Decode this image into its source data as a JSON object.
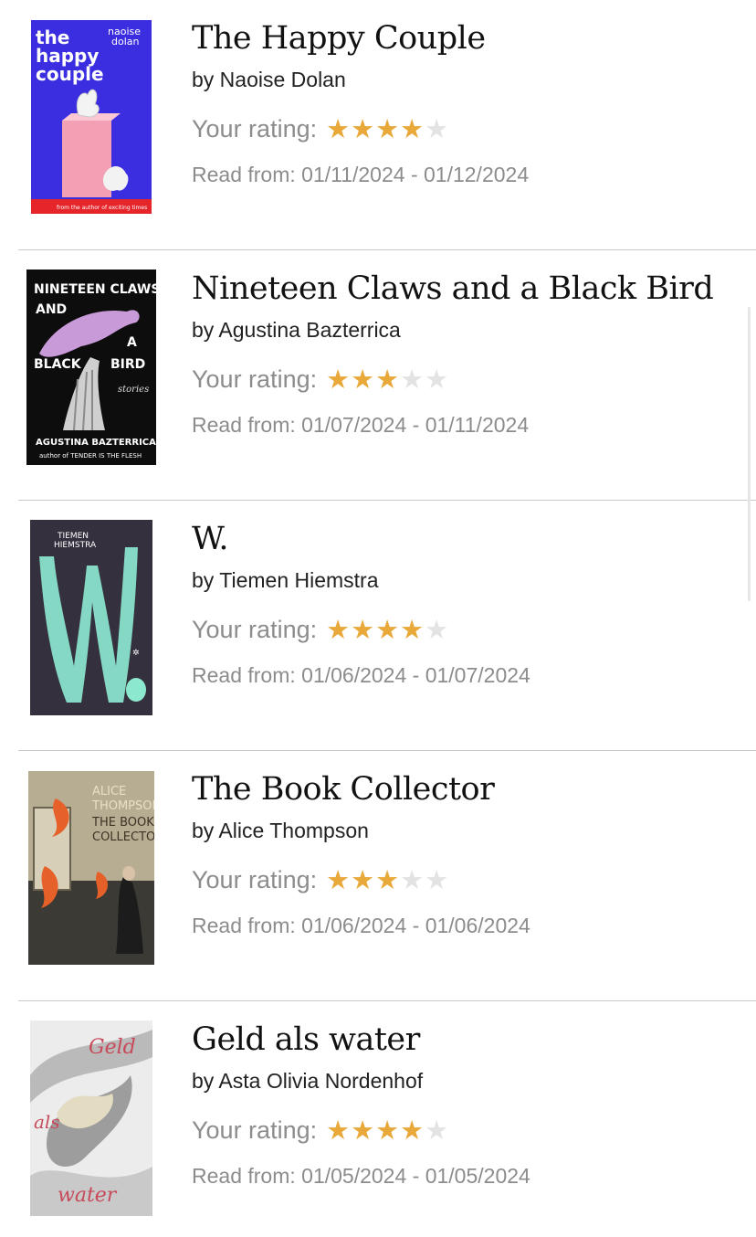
{
  "labels": {
    "rating_prefix": "Your rating:"
  },
  "colors": {
    "star_on": "#e8a93a",
    "star_off": "#e3e3e3",
    "text_muted": "#8c8c8c"
  },
  "books": [
    {
      "title": "The Happy Couple",
      "author": "by Naoise Dolan",
      "rating": 4,
      "max_rating": 5,
      "read_dates": "Read from: 01/11/2024 - 01/12/2024",
      "cover": {
        "title_text": "the happy couple",
        "author_text": "naoise dolan",
        "tagline": "from the author of exciting times"
      }
    },
    {
      "title": "Nineteen Claws and a Black Bird",
      "author": "by Agustina Bazterrica",
      "rating": 3,
      "max_rating": 5,
      "read_dates": "Read from: 01/07/2024 - 01/11/2024",
      "cover": {
        "title_text": "NINETEEN CLAWS AND A BLACK BIRD",
        "subtitle": "stories",
        "author_text": "AGUSTINA BAZTERRICA",
        "tagline": "author of TENDER IS THE FLESH"
      }
    },
    {
      "title": "W.",
      "author": "by Tiemen Hiemstra",
      "rating": 4,
      "max_rating": 5,
      "read_dates": "Read from: 01/06/2024 - 01/07/2024",
      "cover": {
        "author_text": "TIEMEN HIEMSTRA",
        "title_text": "W."
      }
    },
    {
      "title": "The Book Collector",
      "author": "by Alice Thompson",
      "rating": 3,
      "max_rating": 5,
      "read_dates": "Read from: 01/06/2024 - 01/06/2024",
      "cover": {
        "author_text": "ALICE THOMPSON",
        "title_text": "THE BOOK COLLECTOR"
      }
    },
    {
      "title": "Geld als water",
      "author": "by Asta Olivia Nordenhof",
      "rating": 4,
      "max_rating": 5,
      "read_dates": "Read from: 01/05/2024 - 01/05/2024",
      "cover": {
        "title_text": "Geld als water"
      }
    }
  ]
}
